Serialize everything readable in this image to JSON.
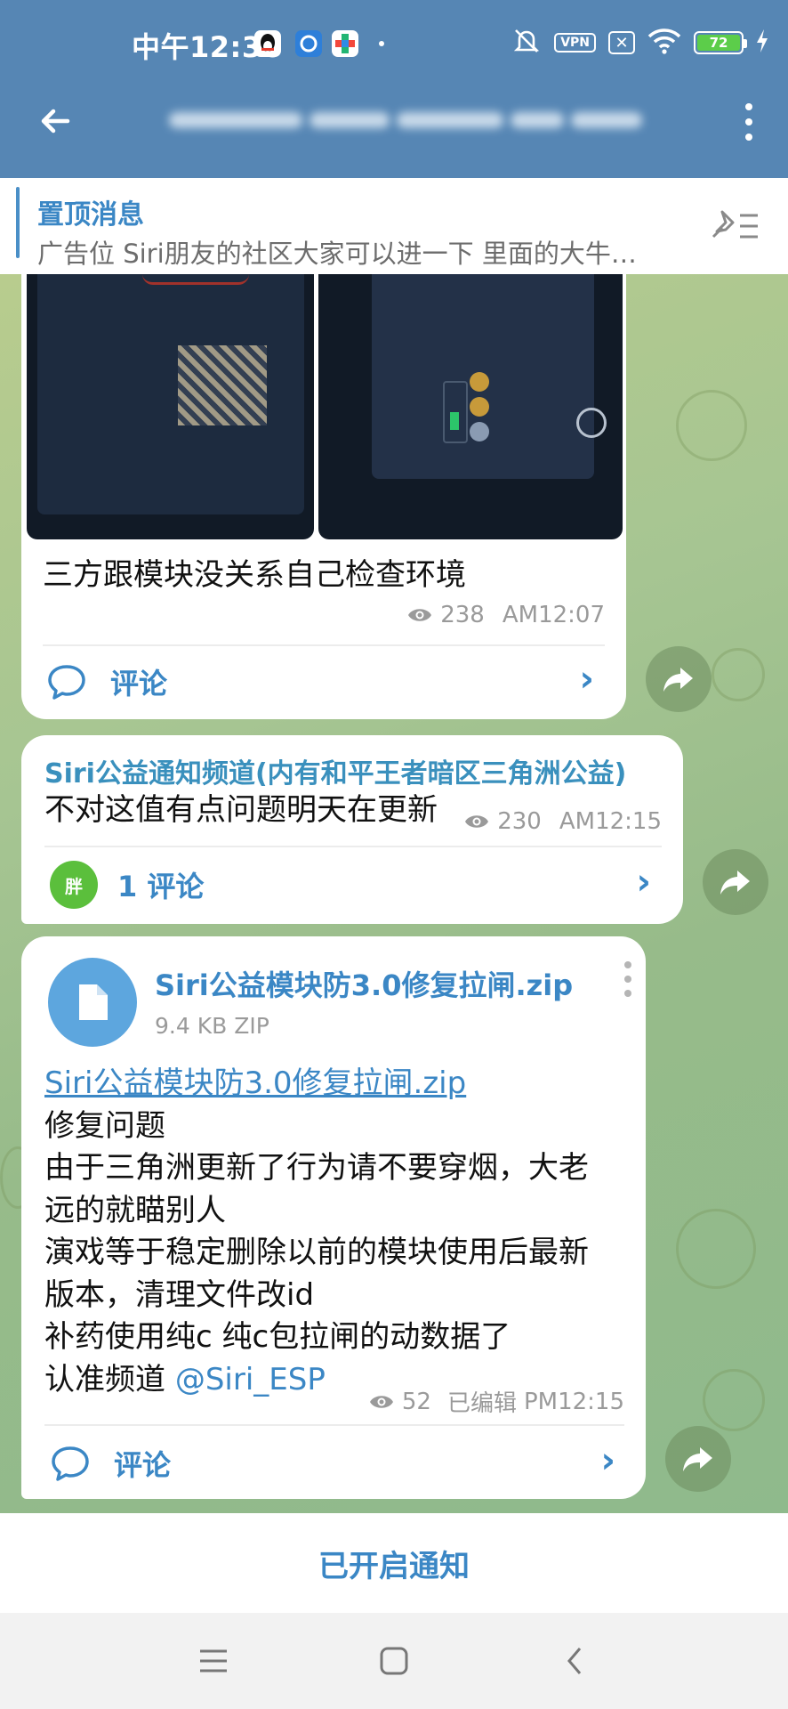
{
  "status_bar": {
    "time": "中午12:36",
    "vpn_label": "VPN",
    "battery": "72",
    "icons": [
      "qq-icon",
      "app-icon",
      "game-icon",
      "mute-icon",
      "vpn-icon",
      "x-icon",
      "wifi-icon",
      "battery-icon",
      "charging-icon"
    ]
  },
  "header": {
    "back_icon": "arrow-left-icon",
    "more_icon": "more-vertical-icon"
  },
  "pinned": {
    "title": "置顶消息",
    "text": "广告位 Siri朋友的社区大家可以进一下 里面的大牛…",
    "icon": "unpin-list-icon"
  },
  "messages": [
    {
      "text": "三方跟模块没关系自己检查环境",
      "views": "238",
      "time": "AM12:07",
      "comment_label": "评论"
    },
    {
      "sender": "Siri公益通知频道(内有和平王者暗区三角洲公益)",
      "text": "不对这值有点问题明天在更新",
      "views": "230",
      "time": "AM12:15",
      "avatar_text": "胖",
      "comment_label": "1 评论"
    },
    {
      "file_name": "Siri公益模块防3.0修复拉闸.zip",
      "file_size": "9.4 KB ZIP",
      "link_text": "Siri公益模块防3.0修复拉闸.zip",
      "lines": [
        "修复问题",
        "由于三角洲更新了行为请不要穿烟，大老",
        "远的就瞄别人",
        "演戏等于稳定删除以前的模块使用后最新",
        "版本，清理文件改id",
        "补药使用纯c 纯c包拉闸的动数据了"
      ],
      "last_line_prefix": "认准频道 ",
      "mention": "@Siri_ESP",
      "views": "52",
      "edited": "已编辑",
      "time": "PM12:15",
      "comment_label": "评论"
    }
  ],
  "bottom": {
    "notify_label": "已开启通知"
  },
  "colors": {
    "header": "#5686b4",
    "accent": "#3b87c5",
    "sender": "#3a90bd",
    "battery": "#5ccd4a"
  }
}
